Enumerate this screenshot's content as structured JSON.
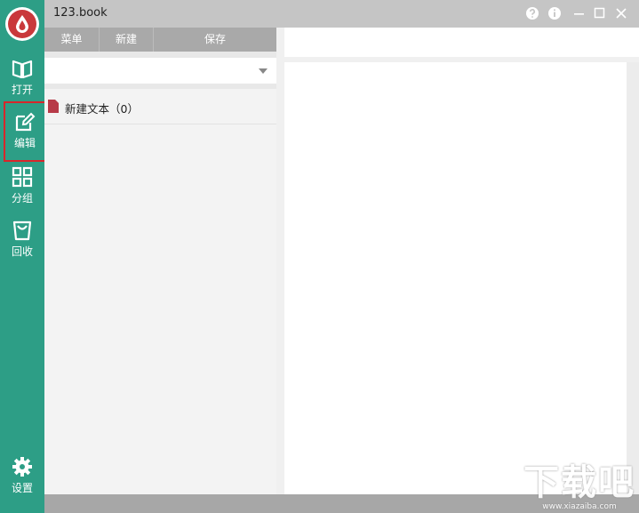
{
  "window": {
    "title": "123.book"
  },
  "sidebar": {
    "items": [
      {
        "label": "打开",
        "icon": "book-open-icon"
      },
      {
        "label": "编辑",
        "icon": "edit-icon",
        "active": true
      },
      {
        "label": "分组",
        "icon": "grid-icon"
      },
      {
        "label": "回收",
        "icon": "recycle-bin-icon"
      }
    ],
    "settings_label": "设置"
  },
  "toolbar": {
    "menu_label": "菜单",
    "new_label": "新建",
    "save_label": "保存"
  },
  "notes": {
    "dropdown_value": "",
    "items": [
      {
        "label": "新建文本（0）"
      }
    ]
  },
  "colors": {
    "sidebar": "#2d9e86",
    "logo": "#c9383b",
    "doc_icon": "#b73a48",
    "highlight": "#d8262b"
  },
  "watermark": {
    "text": "下载吧",
    "url": "www.xiazaiba.com"
  }
}
